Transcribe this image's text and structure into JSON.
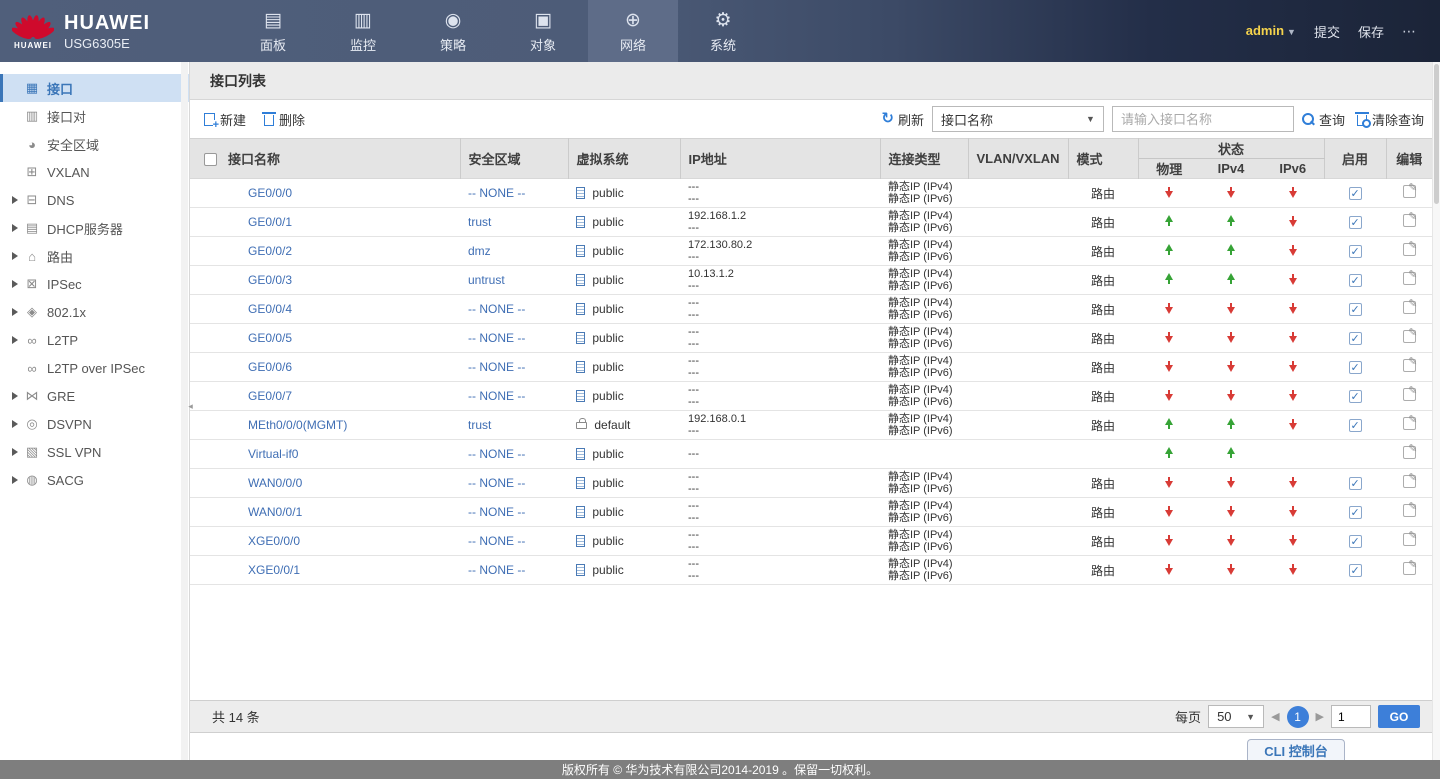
{
  "header": {
    "brand": {
      "logo_word": "HUAWEI",
      "name": "HUAWEI",
      "model": "USG6305E"
    },
    "nav": [
      {
        "label": "面板",
        "icon": "dashboard-icon",
        "glyph": "▤",
        "active": false
      },
      {
        "label": "监控",
        "icon": "monitor-icon",
        "glyph": "▥",
        "active": false
      },
      {
        "label": "策略",
        "icon": "policy-compass-icon",
        "glyph": "◉",
        "active": false
      },
      {
        "label": "对象",
        "icon": "objects-icon",
        "glyph": "▣",
        "active": false
      },
      {
        "label": "网络",
        "icon": "network-globe-icon",
        "glyph": "⊕",
        "active": true
      },
      {
        "label": "系统",
        "icon": "system-gear-icon",
        "glyph": "⚙",
        "active": false
      }
    ],
    "user": {
      "name": "admin"
    },
    "submit_label": "提交",
    "save_label": "保存",
    "more_label": "⋯"
  },
  "sidebar": {
    "items": [
      {
        "label": "接口",
        "icon": "interface-icon",
        "glyph": "▦",
        "expandable": false,
        "active": true
      },
      {
        "label": "接口对",
        "icon": "interface-pair-icon",
        "glyph": "▥",
        "expandable": false,
        "active": false
      },
      {
        "label": "安全区域",
        "icon": "security-zone-icon",
        "glyph": "◕",
        "expandable": false,
        "active": false
      },
      {
        "label": "VXLAN",
        "icon": "vxlan-icon",
        "glyph": "⊞",
        "expandable": false,
        "active": false
      },
      {
        "label": "DNS",
        "icon": "dns-icon",
        "glyph": "⊟",
        "expandable": true,
        "active": false
      },
      {
        "label": "DHCP服务器",
        "icon": "dhcp-server-icon",
        "glyph": "▤",
        "expandable": true,
        "active": false
      },
      {
        "label": "路由",
        "icon": "route-icon",
        "glyph": "⌂",
        "expandable": true,
        "active": false
      },
      {
        "label": "IPSec",
        "icon": "ipsec-lock-icon",
        "glyph": "⊠",
        "expandable": true,
        "active": false
      },
      {
        "label": "802.1x",
        "icon": "dot1x-icon",
        "glyph": "◈",
        "expandable": true,
        "active": false
      },
      {
        "label": "L2TP",
        "icon": "l2tp-icon",
        "glyph": "∞",
        "expandable": true,
        "active": false
      },
      {
        "label": "L2TP over IPSec",
        "icon": "l2tp-over-ipsec-icon",
        "glyph": "∞",
        "expandable": false,
        "active": false
      },
      {
        "label": "GRE",
        "icon": "gre-icon",
        "glyph": "⋈",
        "expandable": true,
        "active": false
      },
      {
        "label": "DSVPN",
        "icon": "dsvpn-icon",
        "glyph": "◎",
        "expandable": true,
        "active": false
      },
      {
        "label": "SSL VPN",
        "icon": "ssl-vpn-icon",
        "glyph": "▧",
        "expandable": true,
        "active": false
      },
      {
        "label": "SACG",
        "icon": "sacg-shield-icon",
        "glyph": "◍",
        "expandable": true,
        "active": false
      }
    ]
  },
  "page": {
    "title": "接口列表"
  },
  "toolbar": {
    "new_label": "新建",
    "delete_label": "删除",
    "refresh_label": "刷新",
    "filter_selected": "接口名称",
    "search_placeholder": "请输入接口名称",
    "query_label": "查询",
    "clear_label": "清除查询"
  },
  "table": {
    "columns": {
      "name": "接口名称",
      "zone": "安全区域",
      "vsys": "虚拟系统",
      "ip": "IP地址",
      "conn": "连接类型",
      "vlan": "VLAN/VXLAN",
      "mode": "模式",
      "status": "状态",
      "phy": "物理",
      "ipv4": "IPv4",
      "ipv6": "IPv6",
      "enable": "启用",
      "edit": "编辑"
    },
    "rows": [
      {
        "name": "GE0/0/0",
        "zone": "-- NONE --",
        "vsys": "public",
        "vsys_icon": "doc",
        "ip1": "---",
        "ip2": "---",
        "conn1": "静态IP (IPv4)",
        "conn2": "静态IP (IPv6)",
        "vlan": "",
        "mode": "路由",
        "phy": "down",
        "ipv4": "down",
        "ipv6": "down",
        "enabled": true
      },
      {
        "name": "GE0/0/1",
        "zone": "trust",
        "vsys": "public",
        "vsys_icon": "doc",
        "ip1": "192.168.1.2",
        "ip2": "---",
        "conn1": "静态IP (IPv4)",
        "conn2": "静态IP (IPv6)",
        "vlan": "",
        "mode": "路由",
        "phy": "up",
        "ipv4": "up",
        "ipv6": "down",
        "enabled": true
      },
      {
        "name": "GE0/0/2",
        "zone": "dmz",
        "vsys": "public",
        "vsys_icon": "doc",
        "ip1": "172.130.80.2",
        "ip2": "---",
        "conn1": "静态IP (IPv4)",
        "conn2": "静态IP (IPv6)",
        "vlan": "",
        "mode": "路由",
        "phy": "up",
        "ipv4": "up",
        "ipv6": "down",
        "enabled": true
      },
      {
        "name": "GE0/0/3",
        "zone": "untrust",
        "vsys": "public",
        "vsys_icon": "doc",
        "ip1": "10.13.1.2",
        "ip2": "---",
        "conn1": "静态IP (IPv4)",
        "conn2": "静态IP (IPv6)",
        "vlan": "",
        "mode": "路由",
        "phy": "up",
        "ipv4": "up",
        "ipv6": "down",
        "enabled": true
      },
      {
        "name": "GE0/0/4",
        "zone": "-- NONE --",
        "vsys": "public",
        "vsys_icon": "doc",
        "ip1": "---",
        "ip2": "---",
        "conn1": "静态IP (IPv4)",
        "conn2": "静态IP (IPv6)",
        "vlan": "",
        "mode": "路由",
        "phy": "down",
        "ipv4": "down",
        "ipv6": "down",
        "enabled": true
      },
      {
        "name": "GE0/0/5",
        "zone": "-- NONE --",
        "vsys": "public",
        "vsys_icon": "doc",
        "ip1": "---",
        "ip2": "---",
        "conn1": "静态IP (IPv4)",
        "conn2": "静态IP (IPv6)",
        "vlan": "",
        "mode": "路由",
        "phy": "down",
        "ipv4": "down",
        "ipv6": "down",
        "enabled": true
      },
      {
        "name": "GE0/0/6",
        "zone": "-- NONE --",
        "vsys": "public",
        "vsys_icon": "doc",
        "ip1": "---",
        "ip2": "---",
        "conn1": "静态IP (IPv4)",
        "conn2": "静态IP (IPv6)",
        "vlan": "",
        "mode": "路由",
        "phy": "down",
        "ipv4": "down",
        "ipv6": "down",
        "enabled": true
      },
      {
        "name": "GE0/0/7",
        "zone": "-- NONE --",
        "vsys": "public",
        "vsys_icon": "doc",
        "ip1": "---",
        "ip2": "---",
        "conn1": "静态IP (IPv4)",
        "conn2": "静态IP (IPv6)",
        "vlan": "",
        "mode": "路由",
        "phy": "down",
        "ipv4": "down",
        "ipv6": "down",
        "enabled": true
      },
      {
        "name": "MEth0/0/0(MGMT)",
        "zone": "trust",
        "vsys": "default",
        "vsys_icon": "lock",
        "ip1": "192.168.0.1",
        "ip2": "---",
        "conn1": "静态IP (IPv4)",
        "conn2": "静态IP (IPv6)",
        "vlan": "",
        "mode": "路由",
        "phy": "up",
        "ipv4": "up",
        "ipv6": "down",
        "enabled": true
      },
      {
        "name": "Virtual-if0",
        "zone": "-- NONE --",
        "vsys": "public",
        "vsys_icon": "doc",
        "ip1": "---",
        "ip2": "",
        "conn1": "",
        "conn2": "",
        "vlan": "",
        "mode": "",
        "phy": "up",
        "ipv4": "up",
        "ipv6": "",
        "enabled": false
      },
      {
        "name": "WAN0/0/0",
        "zone": "-- NONE --",
        "vsys": "public",
        "vsys_icon": "doc",
        "ip1": "---",
        "ip2": "---",
        "conn1": "静态IP (IPv4)",
        "conn2": "静态IP (IPv6)",
        "vlan": "",
        "mode": "路由",
        "phy": "down",
        "ipv4": "down",
        "ipv6": "down",
        "enabled": true
      },
      {
        "name": "WAN0/0/1",
        "zone": "-- NONE --",
        "vsys": "public",
        "vsys_icon": "doc",
        "ip1": "---",
        "ip2": "---",
        "conn1": "静态IP (IPv4)",
        "conn2": "静态IP (IPv6)",
        "vlan": "",
        "mode": "路由",
        "phy": "down",
        "ipv4": "down",
        "ipv6": "down",
        "enabled": true
      },
      {
        "name": "XGE0/0/0",
        "zone": "-- NONE --",
        "vsys": "public",
        "vsys_icon": "doc",
        "ip1": "---",
        "ip2": "---",
        "conn1": "静态IP (IPv4)",
        "conn2": "静态IP (IPv6)",
        "vlan": "",
        "mode": "路由",
        "phy": "down",
        "ipv4": "down",
        "ipv6": "down",
        "enabled": true
      },
      {
        "name": "XGE0/0/1",
        "zone": "-- NONE --",
        "vsys": "public",
        "vsys_icon": "doc",
        "ip1": "---",
        "ip2": "---",
        "conn1": "静态IP (IPv4)",
        "conn2": "静态IP (IPv6)",
        "vlan": "",
        "mode": "路由",
        "phy": "down",
        "ipv4": "down",
        "ipv6": "down",
        "enabled": true
      }
    ]
  },
  "pagination": {
    "total_label": "共 14 条",
    "per_page_label": "每页",
    "per_page": "50",
    "current_page": "1",
    "goto_value": "1",
    "go_label": "GO"
  },
  "cli": {
    "label": "CLI 控制台"
  },
  "footer": {
    "copyright": "版权所有 © 华为技术有限公司2014-2019 。保留一切权利。"
  },
  "colors": {
    "accent_blue": "#3d7fd9",
    "link_blue": "#3f6eb4",
    "status_up_green": "#36a336",
    "status_down_red": "#d83b36",
    "admin_yellow": "#f5d34c",
    "header_dark": "#1b2438",
    "header_slate": "#4d5c78",
    "sidebar_active_bg": "#cfe0f3"
  }
}
